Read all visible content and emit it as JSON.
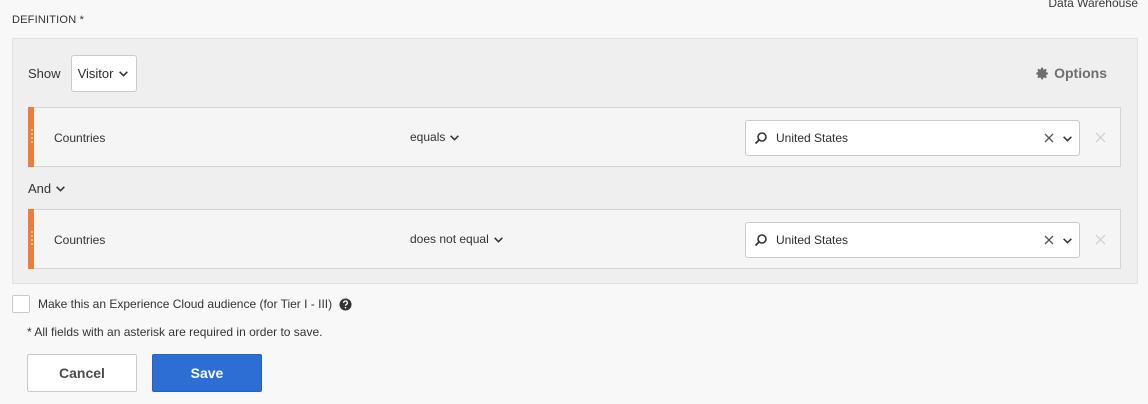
{
  "header": {
    "top_link": "Data Warehouse",
    "definition_label": "DEFINITION *"
  },
  "definition": {
    "show_label": "Show",
    "show_select_value": "Visitor",
    "options_label": "Options",
    "rules": [
      {
        "dimension": "Countries",
        "operator": "equals",
        "value": "United States"
      },
      {
        "dimension": "Countries",
        "operator": "does not equal",
        "value": "United States"
      }
    ],
    "conjunction": "And"
  },
  "audience": {
    "checkbox_label": "Make this an Experience Cloud audience (for Tier I - III)",
    "checked": false
  },
  "required_note": "* All fields with an asterisk are required in order to save.",
  "buttons": {
    "cancel": "Cancel",
    "save": "Save"
  },
  "colors": {
    "accent": "#2c6ed4",
    "rule_handle": "#ee7c3b",
    "panel_bg": "#efefef"
  }
}
